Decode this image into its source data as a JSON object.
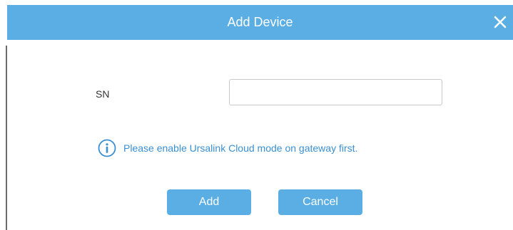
{
  "dialog": {
    "title": "Add Device",
    "close_icon": "close-icon"
  },
  "form": {
    "sn_label": "SN",
    "sn_value": "",
    "sn_placeholder": ""
  },
  "hint": {
    "icon": "info-icon",
    "text": "Please enable Ursalink Cloud mode on gateway first."
  },
  "buttons": {
    "add_label": "Add",
    "cancel_label": "Cancel"
  },
  "colors": {
    "accent": "#5aaee3",
    "hint_text": "#3a8fd1",
    "title_text": "#ffffff"
  }
}
